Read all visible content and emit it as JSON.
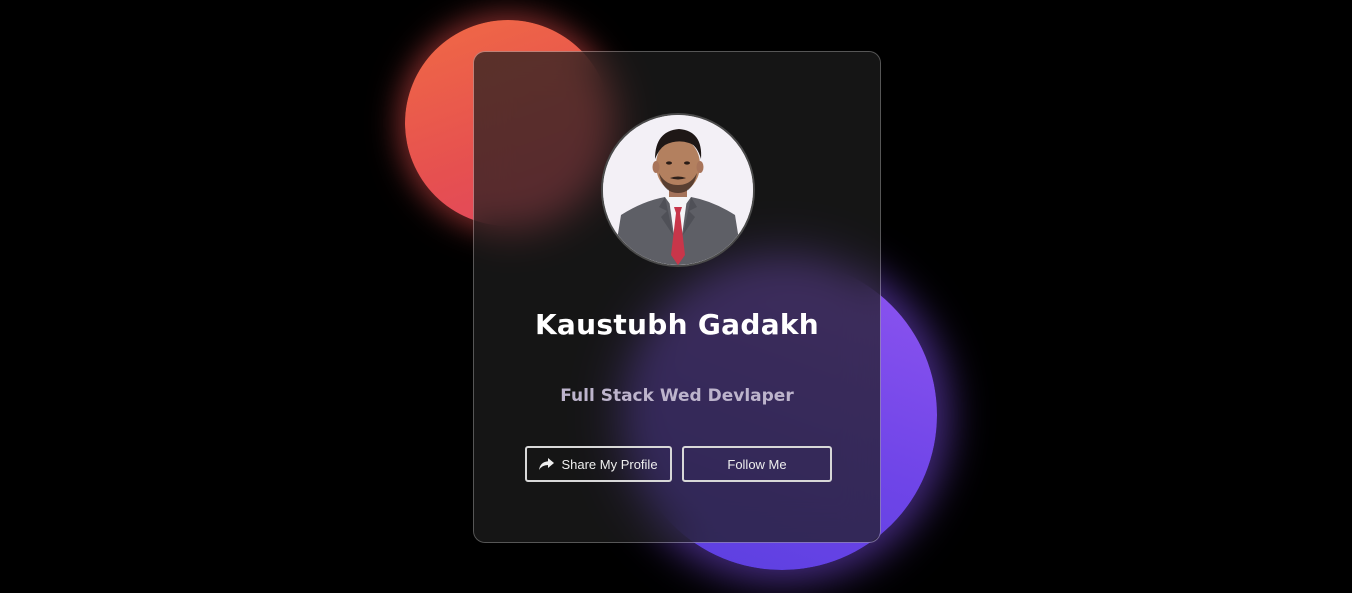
{
  "profile": {
    "name": "Kaustubh Gadakh",
    "role": "Full Stack Wed Devlaper"
  },
  "actions": {
    "share_label": "Share My Profile",
    "share_icon": "share-arrow-icon",
    "follow_label": "Follow Me"
  },
  "colors": {
    "background": "#000000",
    "red_blob": "#e65050",
    "purple_blob": "#7a4ce8",
    "name_text": "#ffffff",
    "role_text": "#bdb4cc"
  }
}
